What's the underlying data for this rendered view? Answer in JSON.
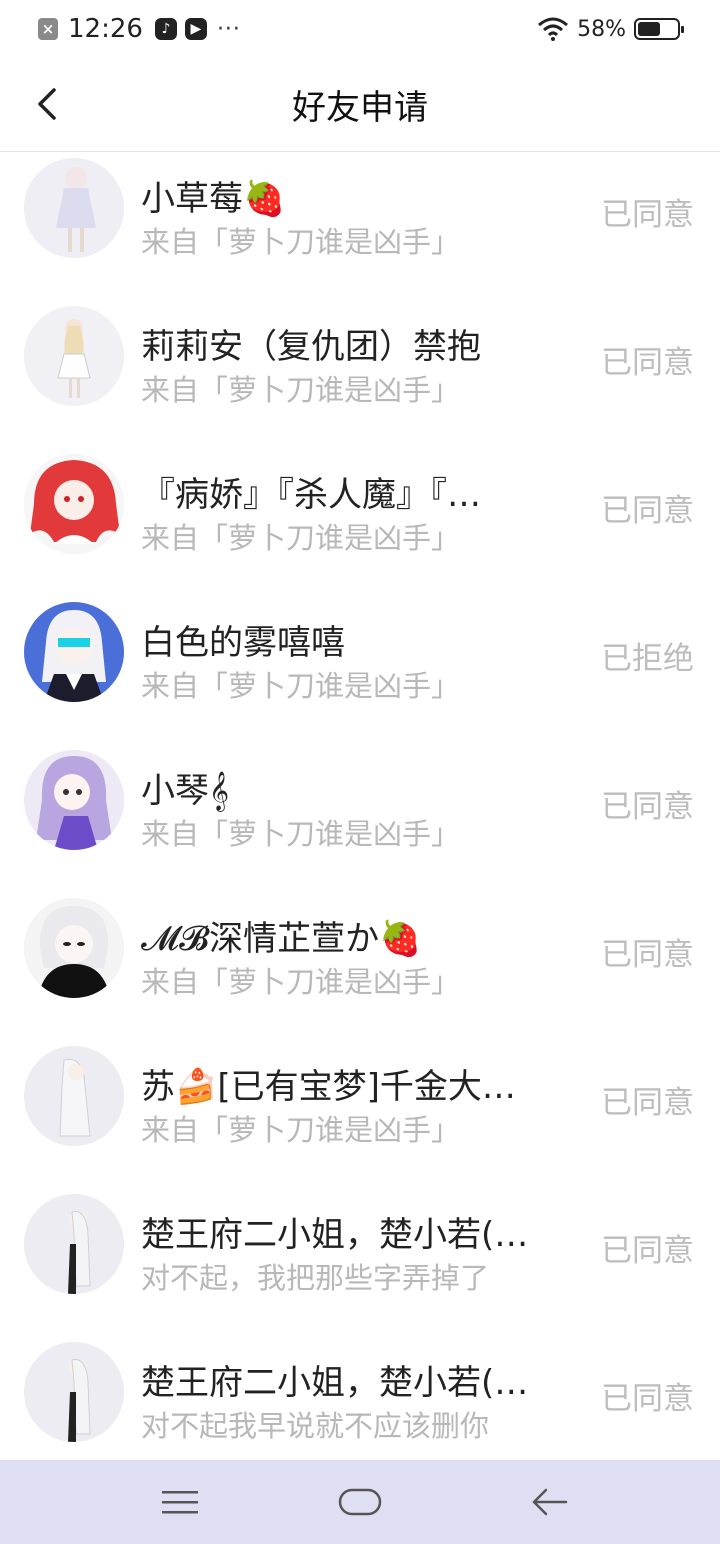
{
  "status_bar": {
    "time": "12:26",
    "battery_percent": "58%",
    "battery_level": 0.58,
    "left_icons": [
      "notification-dismiss-icon",
      "tiktok-icon",
      "video-app-icon",
      "more-dots-icon"
    ],
    "right_icons": [
      "wifi-icon",
      "battery-icon"
    ]
  },
  "header": {
    "title": "好友申请",
    "back_icon": "chevron-left-icon"
  },
  "requests": [
    {
      "name": "小草莓🍓",
      "subtitle": "来自「萝卜刀谁是凶手」",
      "status": "已同意"
    },
    {
      "name": "莉莉安（复仇团）禁抱",
      "subtitle": "来自「萝卜刀谁是凶手」",
      "status": "已同意"
    },
    {
      "name": "『病娇』『杀人魔』『…",
      "subtitle": "来自「萝卜刀谁是凶手」",
      "status": "已同意"
    },
    {
      "name": "白色的雾嘻嘻",
      "subtitle": "来自「萝卜刀谁是凶手」",
      "status": "已拒绝"
    },
    {
      "name": "小琴𝄞",
      "subtitle": "来自「萝卜刀谁是凶手」",
      "status": "已同意"
    },
    {
      "name": "𝓜𝓑深情芷萱か🍓",
      "subtitle": "来自「萝卜刀谁是凶手」",
      "status": "已同意"
    },
    {
      "name": "苏🍰[已有宝梦]千金大…",
      "subtitle": "来自「萝卜刀谁是凶手」",
      "status": "已同意"
    },
    {
      "name": "楚王府二小姐，楚小若(…",
      "subtitle": "对不起，我把那些字弄掉了",
      "status": "已同意"
    },
    {
      "name": "楚王府二小姐，楚小若(…",
      "subtitle": "对不起我早说就不应该删你",
      "status": "已同意"
    }
  ],
  "nav_bar": {
    "icons": [
      "menu-icon",
      "home-icon",
      "back-arrow-icon"
    ]
  },
  "colors": {
    "nav_background": "#dedff3",
    "status_text": "#bdbdbd",
    "subtitle_text": "#b8b8b8"
  }
}
